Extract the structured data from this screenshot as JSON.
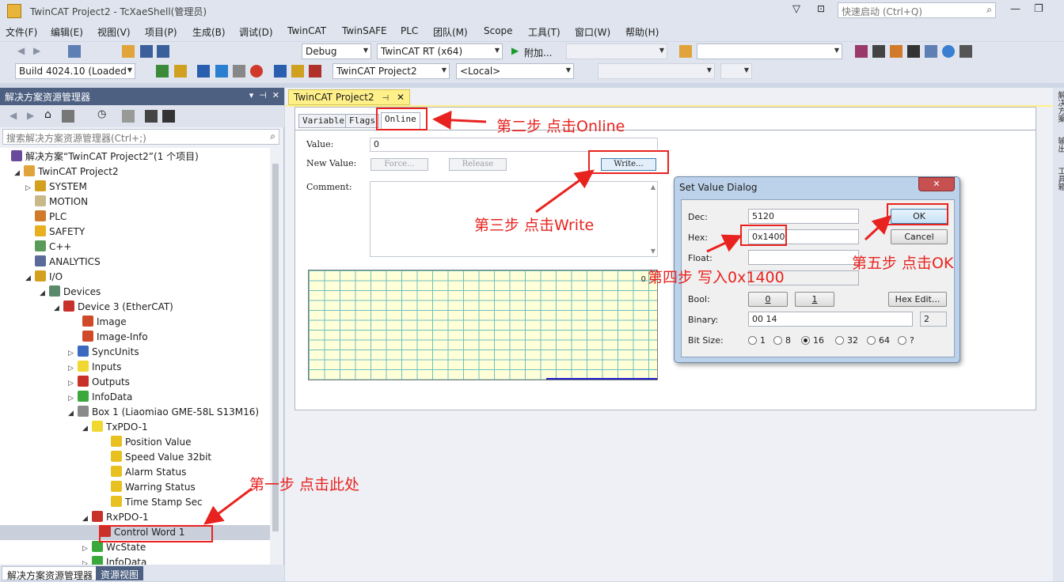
{
  "window": {
    "title": "TwinCAT Project2 - TcXaeShell(管理员)",
    "quick_launch": "快速启动 (Ctrl+Q)"
  },
  "menu": [
    "文件(F)",
    "编辑(E)",
    "视图(V)",
    "项目(P)",
    "生成(B)",
    "调试(D)",
    "TwinCAT",
    "TwinSAFE",
    "PLC",
    "团队(M)",
    "Scope",
    "工具(T)",
    "窗口(W)",
    "帮助(H)"
  ],
  "toolbar1": {
    "config": "Debug",
    "platform": "TwinCAT RT (x64)",
    "attach": "附加..."
  },
  "toolbar2": {
    "build": "Build 4024.10 (Loaded",
    "project": "TwinCAT Project2",
    "target": "<Local>"
  },
  "solution_explorer": {
    "title": "解决方案资源管理器",
    "search_placeholder": "搜索解决方案资源管理器(Ctrl+;)",
    "tree": [
      "解决方案“TwinCAT Project2”(1 个项目)",
      "TwinCAT Project2",
      "SYSTEM",
      "MOTION",
      "PLC",
      "SAFETY",
      "C++",
      "ANALYTICS",
      "I/O",
      "Devices",
      "Device 3 (EtherCAT)",
      "Image",
      "Image-Info",
      "SyncUnits",
      "Inputs",
      "Outputs",
      "InfoData",
      "Box 1 (Liaomiao GME-58L S13M16)",
      "TxPDO-1",
      "Position Value",
      "Speed Value 32bit",
      "Alarm Status",
      "Warring Status",
      "Time Stamp Sec",
      "RxPDO-1",
      "Control Word 1",
      "WcState",
      "InfoData"
    ],
    "bottom_tabs": [
      "解决方案资源管理器",
      "资源视图"
    ]
  },
  "document": {
    "tab": "TwinCAT Project2",
    "tabs": [
      "Variable",
      "Flags",
      "Online"
    ],
    "value_label": "Value:",
    "value": "0",
    "new_value_label": "New Value:",
    "force": "Force...",
    "release": "Release",
    "write": "Write...",
    "comment_label": "Comment:",
    "grid_zero": "0"
  },
  "right_strip": [
    "解决方案",
    "输出",
    "工具箱"
  ],
  "dialog": {
    "title": "Set Value Dialog",
    "close": "✕",
    "dec_label": "Dec:",
    "dec": "5120",
    "hex_label": "Hex:",
    "hex": "0x1400",
    "float_label": "Float:",
    "bool_label": "Bool:",
    "bool0": "0",
    "bool1": "1",
    "hex_edit": "Hex Edit...",
    "binary_label": "Binary:",
    "binary": "00 14",
    "binary_len": "2",
    "bitsize_label": "Bit Size:",
    "bitsizes": [
      "1",
      "8",
      "16",
      "32",
      "64",
      "?"
    ],
    "ok": "OK",
    "cancel": "Cancel"
  },
  "annotations": {
    "step1": "第一步 点击此处",
    "step2": "第二步 点击Online",
    "step3": "第三步 点击Write",
    "step4": "第四步 写入0x1400",
    "step5": "第五步 点击OK"
  },
  "colors": {
    "annotation": "#e8231f",
    "tab_active": "#fff08a",
    "panel_header": "#4d6082"
  }
}
